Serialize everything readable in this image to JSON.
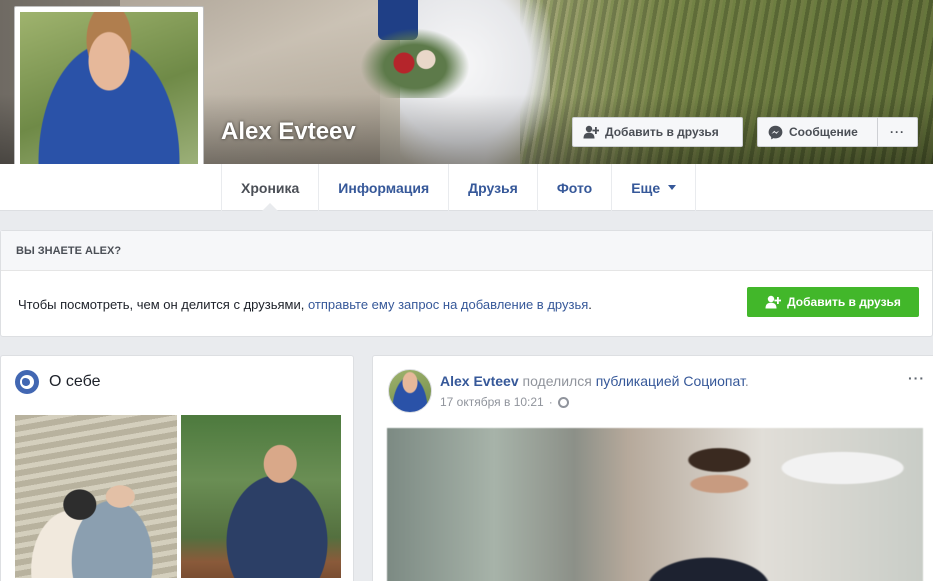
{
  "profile": {
    "name": "Alex Evteev"
  },
  "header_buttons": {
    "add_friend": "Добавить в друзья",
    "message": "Сообщение",
    "more": "···"
  },
  "tabs": [
    {
      "label": "Хроника",
      "active": true
    },
    {
      "label": "Информация",
      "active": false
    },
    {
      "label": "Друзья",
      "active": false
    },
    {
      "label": "Фото",
      "active": false
    },
    {
      "label": "Еще",
      "active": false,
      "has_caret": true
    }
  ],
  "know_card": {
    "heading": "ВЫ ЗНАЕТЕ ALEX?",
    "text_before": "Чтобы посмотреть, чем он делится с друзьями,",
    "link_text": "отправьте ему запрос на добавление в друзья",
    "text_after": ".",
    "button_label": "Добавить в друзья"
  },
  "about": {
    "title": "О себе"
  },
  "post": {
    "author": "Alex Evteev",
    "action": "поделился",
    "object_link": "публикацией Социопат",
    "object_suffix": ".",
    "time": "17 октября в 10:21",
    "more": "···"
  },
  "icons": {
    "add_friend": "person-plus-icon",
    "message": "messenger-icon",
    "globe": "globe-icon",
    "privacy": "public-globe-icon"
  },
  "colors": {
    "link": "#365899",
    "green": "#42b72a",
    "background": "#e9ebee"
  }
}
